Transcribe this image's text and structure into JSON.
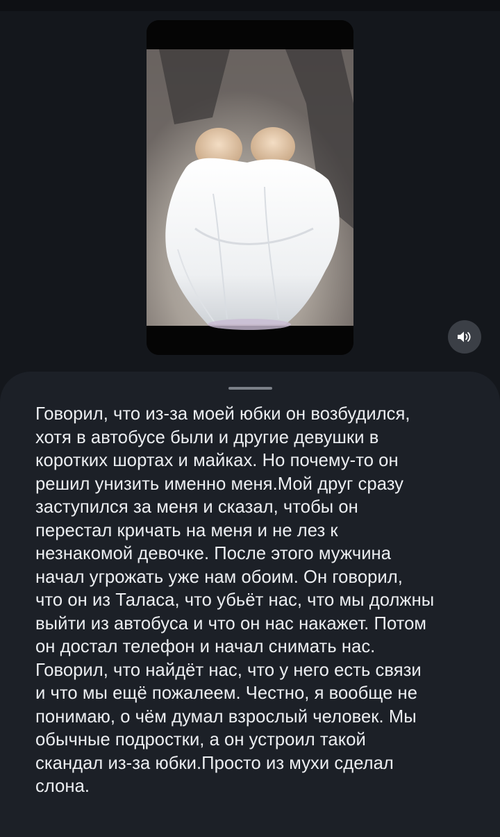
{
  "media": {
    "kind": "video",
    "sound_icon": "speaker-icon"
  },
  "description": {
    "text": "Говорил, что из-за моей юбки он возбудился,\nхотя в автобусе были и другие девушки в\nкоротких шортах и майках. Но почему-то он\nрешил унизить именно меня.Мой друг сразу\nзаступился за меня и сказал, чтобы он\nперестал кричать на меня и не лез к\nнезнакомой девочке. После этого мужчина\nначал угрожать уже нам обоим. Он говорил,\nчто он из Таласа, что убьёт нас, что мы должны\nвыйти из автобуса и что он нас накажет. Потом\nон достал телефон и начал снимать нас.\nГоворил, что найдёт нас, что у него есть связи\nи что мы ещё пожалеем. Честно, я вообще не\nпонимаю, о чём думал взрослый человек. Мы\nобычные подростки, а он устроил такой\nскандал из-за юбки.Просто из мухи сделал\nслона."
  },
  "colors": {
    "background": "#14171c",
    "sheet": "#1c2027",
    "text": "#eceef1",
    "sound_button": "#3b3f46"
  }
}
